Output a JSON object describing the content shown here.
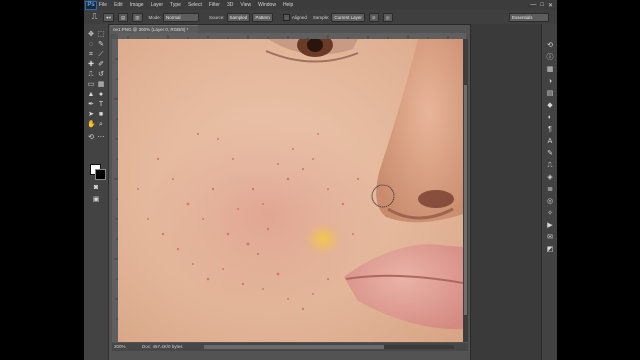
{
  "app": {
    "logo": "Ps",
    "menu": [
      "File",
      "Edit",
      "Image",
      "Layer",
      "Type",
      "Select",
      "Filter",
      "3D",
      "View",
      "Window",
      "Help"
    ],
    "window_controls": [
      "—",
      "□",
      "✕"
    ]
  },
  "options": {
    "mode_label": "Mode:",
    "mode_value": "Normal",
    "source_label": "Source:",
    "source_sampled": "Sampled",
    "source_pattern": "Pattern",
    "aligned_label": "Aligned",
    "sample_label": "Sample:",
    "sample_value": "Current Layer",
    "workspace": "Essentials"
  },
  "document": {
    "tab_label": "ne1.PNG @ 300% (Layer 0, RGB/8) *",
    "zoom": "300%",
    "doc_info": "Doc: 457.4K/0 bytes"
  },
  "colors": {
    "foreground": "#ffffff",
    "background": "#000000",
    "skin": "#e4b99d",
    "blemish": "#c9716a",
    "patch": "#f0c34a"
  },
  "icons": {
    "tools": [
      "move",
      "marquee",
      "lasso",
      "quick-select",
      "crop",
      "eyedropper",
      "spot-heal",
      "brush",
      "clone-stamp",
      "history-brush",
      "eraser",
      "gradient",
      "blur",
      "dodge",
      "pen",
      "type",
      "path-select",
      "shape",
      "hand",
      "zoom"
    ],
    "panels": [
      "history",
      "properties",
      "info",
      "color",
      "swatches",
      "styles",
      "adjustments",
      "paragraph",
      "character",
      "brush-presets",
      "clone-source",
      "navigator",
      "layers",
      "channels",
      "paths",
      "actions",
      "notes",
      "3d"
    ]
  }
}
